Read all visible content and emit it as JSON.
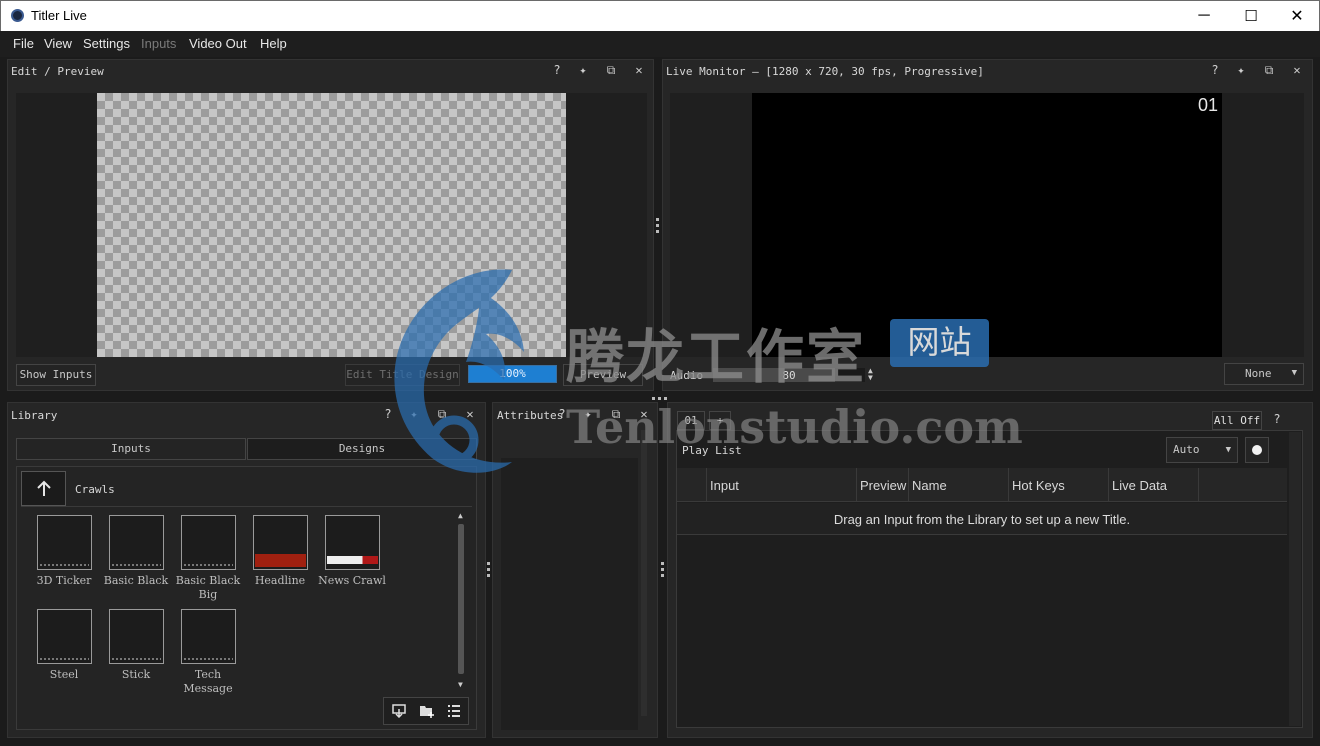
{
  "window": {
    "title": "Titler Live",
    "minimize": "─",
    "maximize": "☐",
    "close": "✕"
  },
  "menu": [
    {
      "label": "File",
      "enabled": true
    },
    {
      "label": "View",
      "enabled": true
    },
    {
      "label": "Settings",
      "enabled": true
    },
    {
      "label": "Inputs",
      "enabled": false
    },
    {
      "label": "Video Out",
      "enabled": true
    },
    {
      "label": "Help",
      "enabled": true
    }
  ],
  "panel_icons": {
    "help": "?",
    "pin": "✦",
    "float": "⧉",
    "close": "✕"
  },
  "edit_preview": {
    "title": "Edit / Preview",
    "show_inputs": "Show Inputs",
    "edit_title_design": "Edit Title Design",
    "zoom": "100%",
    "zoom_fraction": 1.0,
    "preview": "Preview"
  },
  "live_monitor": {
    "title": "Live Monitor – [1280 x 720, 30 fps, Progressive]",
    "channel": "01",
    "audio_label": "Audio",
    "audio_value": "80",
    "audio_fraction": 0.8,
    "output_select": "None"
  },
  "library": {
    "title": "Library",
    "tabs": [
      "Inputs",
      "Designs"
    ],
    "folder": "Crawls",
    "items": [
      {
        "label": "3D Ticker",
        "variant": "plain"
      },
      {
        "label": "Basic Black",
        "variant": "plain"
      },
      {
        "label": "Basic Black Big",
        "variant": "plain"
      },
      {
        "label": "Headline",
        "variant": "red"
      },
      {
        "label": "News Crawl",
        "variant": "white"
      },
      {
        "label": "Steel",
        "variant": "plain"
      },
      {
        "label": "Stick",
        "variant": "plain"
      },
      {
        "label": "Tech Message",
        "variant": "plain"
      }
    ]
  },
  "attributes": {
    "title": "Attributes"
  },
  "playlist": {
    "tab": "01",
    "add_tab": "+",
    "all_off": "All Off",
    "help": "?",
    "title": "Play List",
    "mode": "Auto",
    "columns": [
      "Input",
      "Preview",
      "Name",
      "Hot Keys",
      "Live Data"
    ],
    "empty_message": "Drag an Input from the Library to set up a new Title."
  },
  "watermark": {
    "cn_text": "腾龙工作室",
    "cn_badge": "网站",
    "domain": "Tenlonstudio.com"
  },
  "colors": {
    "accent": "#1e7fd2",
    "watermark_blue": "#2a6db0"
  }
}
